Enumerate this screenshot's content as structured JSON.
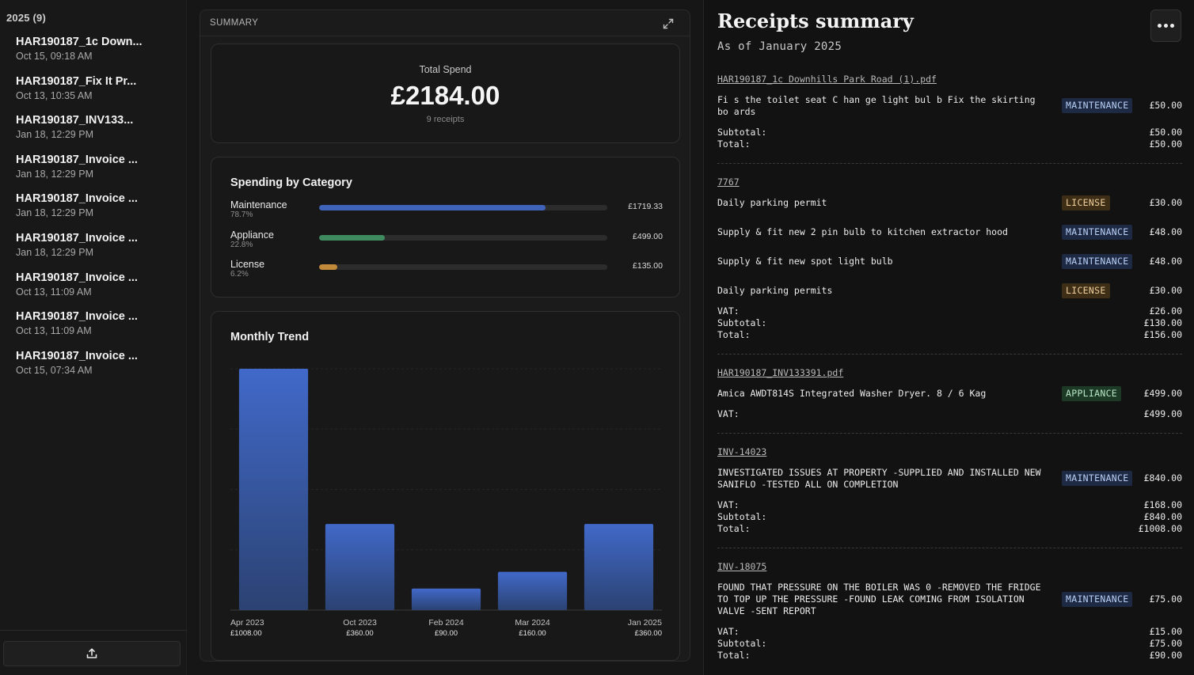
{
  "sidebar": {
    "header": "2025 (9)",
    "files": [
      {
        "name": "HAR190187_1c Down...",
        "date": "Oct 15, 09:18 AM"
      },
      {
        "name": "HAR190187_Fix It Pr...",
        "date": "Oct 13, 10:35 AM"
      },
      {
        "name": "HAR190187_INV133...",
        "date": "Jan 18, 12:29 PM"
      },
      {
        "name": "HAR190187_Invoice ...",
        "date": "Jan 18, 12:29 PM"
      },
      {
        "name": "HAR190187_Invoice ...",
        "date": "Jan 18, 12:29 PM"
      },
      {
        "name": "HAR190187_Invoice ...",
        "date": "Jan 18, 12:29 PM"
      },
      {
        "name": "HAR190187_Invoice ...",
        "date": "Oct 13, 11:09 AM"
      },
      {
        "name": "HAR190187_Invoice ...",
        "date": "Oct 13, 11:09 AM"
      },
      {
        "name": "HAR190187_Invoice ...",
        "date": "Oct 15, 07:34 AM"
      }
    ],
    "upload_icon": "upload-icon"
  },
  "summary": {
    "title": "SUMMARY",
    "expand_icon": "expand-icon",
    "total_label": "Total Spend",
    "total_value": "£2184.00",
    "receipt_count": "9 receipts",
    "category_title": "Spending by Category",
    "categories": [
      {
        "name": "Maintenance",
        "pct": "78.7%",
        "fraction": 0.787,
        "amount": "£1719.33",
        "color": "#3e63b8"
      },
      {
        "name": "Appliance",
        "pct": "22.8%",
        "fraction": 0.228,
        "amount": "£499.00",
        "color": "#3f8b5f"
      },
      {
        "name": "License",
        "pct": "6.2%",
        "fraction": 0.062,
        "amount": "£135.00",
        "color": "#c18a3a"
      }
    ],
    "trend_title": "Monthly Trend"
  },
  "chart_data": {
    "type": "bar",
    "title": "Monthly Trend",
    "categories": [
      "Apr 2023",
      "Oct 2023",
      "Feb 2024",
      "Mar 2024",
      "Jan 2025"
    ],
    "values": [
      1008,
      360,
      90,
      160,
      360
    ],
    "value_labels": [
      "£1008.00",
      "£360.00",
      "£90.00",
      "£160.00",
      "£360.00"
    ],
    "ylim": [
      0,
      1008
    ],
    "grid": true,
    "bar_color": "#3f66c4"
  },
  "receipts": {
    "title": "Receipts summary",
    "subtitle": "As of January 2025",
    "more_icon": "more-horizontal-icon",
    "groups": [
      {
        "link": "HAR190187_1c Downhills Park Road (1).pdf",
        "items": [
          {
            "desc": "Fi s the toilet seat C han ge light bul b Fix the skirting bo ards",
            "badge": "MAINTENANCE",
            "amount": "£50.00"
          }
        ],
        "totals": [
          {
            "k": "Subtotal:",
            "v": "£50.00"
          },
          {
            "k": "Total:",
            "v": "£50.00"
          }
        ]
      },
      {
        "link": "7767",
        "items": [
          {
            "desc": "Daily parking permit",
            "badge": "LICENSE",
            "amount": "£30.00"
          },
          {
            "desc": "Supply & fit new 2 pin bulb to kitchen extractor hood",
            "badge": "MAINTENANCE",
            "amount": "£48.00"
          },
          {
            "desc": "Supply & fit new spot light bulb",
            "badge": "MAINTENANCE",
            "amount": "£48.00"
          },
          {
            "desc": "Daily parking permits",
            "badge": "LICENSE",
            "amount": "£30.00"
          }
        ],
        "totals": [
          {
            "k": "VAT:",
            "v": "£26.00"
          },
          {
            "k": "Subtotal:",
            "v": "£130.00"
          },
          {
            "k": "Total:",
            "v": "£156.00"
          }
        ]
      },
      {
        "link": "HAR190187_INV133391.pdf",
        "items": [
          {
            "desc": "Amica AWDT814S Integrated Washer Dryer. 8 / 6 Kag",
            "badge": "APPLIANCE",
            "amount": "£499.00"
          }
        ],
        "totals": [
          {
            "k": "VAT:",
            "v": "£499.00"
          }
        ]
      },
      {
        "link": "INV-14023",
        "items": [
          {
            "desc": "INVESTIGATED ISSUES AT PROPERTY -SUPPLIED AND INSTALLED NEW SANIFLO -TESTED ALL ON COMPLETION",
            "badge": "MAINTENANCE",
            "amount": "£840.00"
          }
        ],
        "totals": [
          {
            "k": "VAT:",
            "v": "£168.00"
          },
          {
            "k": "Subtotal:",
            "v": "£840.00"
          },
          {
            "k": "Total:",
            "v": "£1008.00"
          }
        ]
      },
      {
        "link": "INV-18075",
        "items": [
          {
            "desc": "FOUND THAT PRESSURE ON THE BOILER WAS 0 -REMOVED THE FRIDGE TO TOP UP THE PRESSURE -FOUND LEAK COMING FROM ISOLATION VALVE -SENT REPORT",
            "badge": "MAINTENANCE",
            "amount": "£75.00"
          }
        ],
        "totals": [
          {
            "k": "VAT:",
            "v": "£15.00"
          },
          {
            "k": "Subtotal:",
            "v": "£75.00"
          },
          {
            "k": "Total:",
            "v": "£90.00"
          }
        ]
      }
    ]
  }
}
